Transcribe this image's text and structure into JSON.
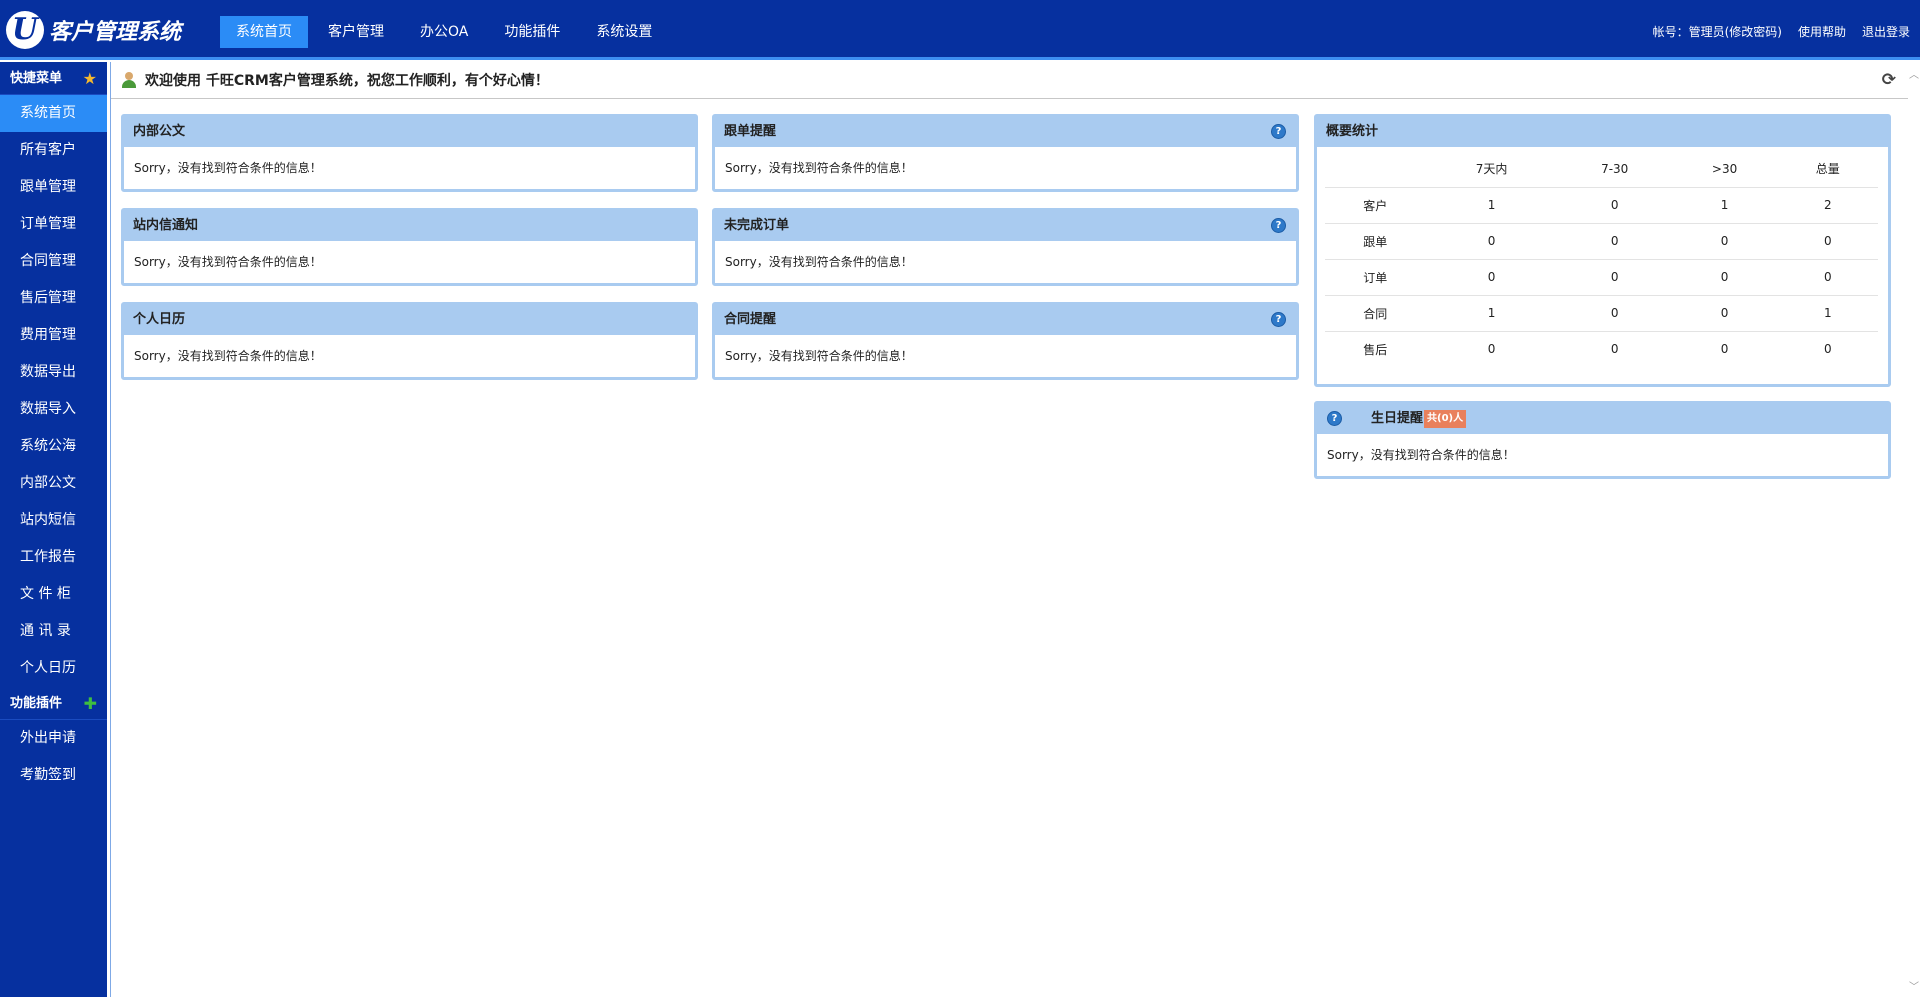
{
  "app": {
    "logo_mark": "U",
    "title": "客户管理系统"
  },
  "topnav": [
    {
      "label": "系统首页",
      "active": true
    },
    {
      "label": "客户管理"
    },
    {
      "label": "办公OA"
    },
    {
      "label": "功能插件"
    },
    {
      "label": "系统设置"
    }
  ],
  "toplinks": {
    "account": "帐号：管理员(修改密码)",
    "help": "使用帮助",
    "logout": "退出登录"
  },
  "sidebar": {
    "quick_title": "快捷菜单",
    "quick_icon": "star-icon",
    "quick_items": [
      "系统首页",
      "所有客户",
      "跟单管理",
      "订单管理",
      "合同管理",
      "售后管理",
      "费用管理",
      "数据导出",
      "数据导入",
      "系统公海",
      "内部公文",
      "站内短信",
      "工作报告",
      "文 件 柜",
      "通 讯 录",
      "个人日历"
    ],
    "plugin_title": "功能插件",
    "plugin_icon": "puzzle-icon",
    "plugin_items": [
      "外出申请",
      "考勤签到"
    ]
  },
  "welcome": "欢迎使用 千旺CRM客户管理系统，祝您工作顺利，有个好心情！",
  "empty_msg": "Sorry，没有找到符合条件的信息！",
  "panels": {
    "docs": "内部公文",
    "messages": "站内信通知",
    "calendar": "个人日历",
    "followup": "跟单提醒",
    "orders": "未完成订单",
    "contracts": "合同提醒",
    "stats": "概要统计",
    "birthday": "生日提醒",
    "birthday_badge": "共(0)人"
  },
  "stats": {
    "headers": [
      "",
      "7天内",
      "7-30",
      ">30",
      "总量"
    ],
    "rows": [
      [
        "客户",
        "1",
        "0",
        "1",
        "2"
      ],
      [
        "跟单",
        "0",
        "0",
        "0",
        "0"
      ],
      [
        "订单",
        "0",
        "0",
        "0",
        "0"
      ],
      [
        "合同",
        "1",
        "0",
        "0",
        "1"
      ],
      [
        "售后",
        "0",
        "0",
        "0",
        "0"
      ]
    ]
  },
  "colors": {
    "header": "#06309f",
    "active": "#2b8cf6",
    "panel_head": "#a9cbf0",
    "badge": "#e9805c"
  }
}
